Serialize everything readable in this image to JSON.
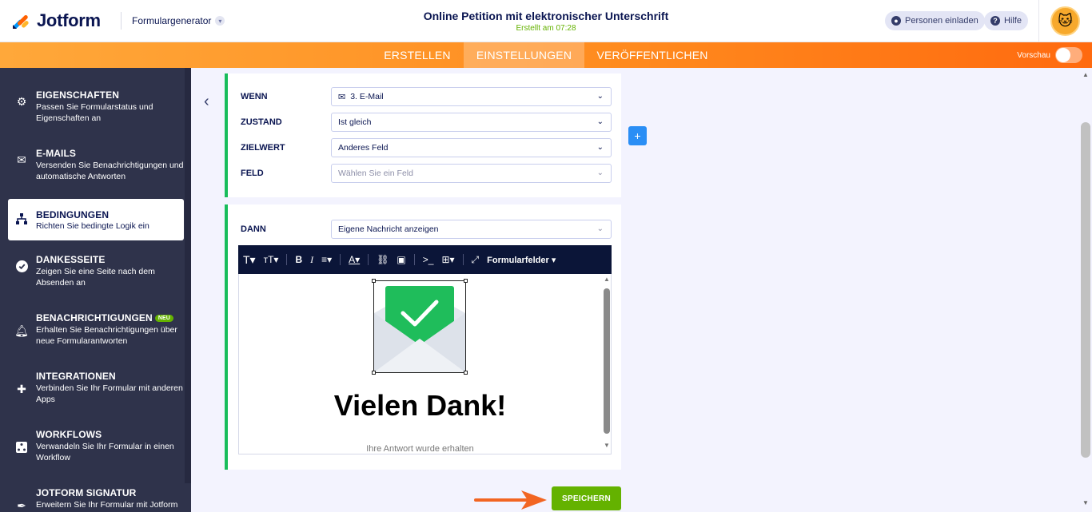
{
  "header": {
    "logo_text": "Jotform",
    "form_builder_label": "Formulargenerator",
    "form_title": "Online Petition mit elektronischer Unterschrift",
    "form_subtitle": "Erstellt am 07:28",
    "invite_label": "Personen einladen",
    "help_label": "Hilfe"
  },
  "nav": {
    "tabs": [
      "ERSTELLEN",
      "EINSTELLUNGEN",
      "VERÖFFENTLICHEN"
    ],
    "active_tab": "EINSTELLUNGEN",
    "preview_label": "Vorschau"
  },
  "sidebar": {
    "items": [
      {
        "title": "EIGENSCHAFTEN",
        "desc": "Passen Sie Formularstatus und Eigenschaften an",
        "icon": "gear-icon"
      },
      {
        "title": "E-MAILS",
        "desc": "Versenden Sie Benachrichtigungen und automatische Antworten",
        "icon": "envelope-icon"
      },
      {
        "title": "BEDINGUNGEN",
        "desc": "Richten Sie bedingte Logik ein",
        "icon": "sitemap-icon",
        "active": true
      },
      {
        "title": "DANKESSEITE",
        "desc": "Zeigen Sie eine Seite nach dem Absenden an",
        "icon": "check-circle-icon"
      },
      {
        "title": "BENACHRICHTIGUNGEN",
        "badge": "NEU",
        "desc": "Erhalten Sie Benachrichtigungen über neue Formularantworten",
        "icon": "bell-icon"
      },
      {
        "title": "INTEGRATIONEN",
        "desc": "Verbinden Sie Ihr Formular mit anderen Apps",
        "icon": "puzzle-icon"
      },
      {
        "title": "WORKFLOWS",
        "desc": "Verwandeln Sie Ihr Formular in einen Workflow",
        "icon": "workflow-icon"
      },
      {
        "title": "JOTFORM SIGNATUR",
        "desc": "Erweitern Sie Ihr Formular mit Jotform",
        "icon": "pen-icon"
      }
    ]
  },
  "condition": {
    "if_label": "WENN",
    "if_value": "3. E-Mail",
    "state_label": "ZUSTAND",
    "state_value": "Ist gleich",
    "target_label": "ZIELWERT",
    "target_value": "Anderes Feld",
    "field_label": "FELD",
    "field_placeholder": "Wählen Sie ein Feld"
  },
  "action": {
    "then_label": "DANN",
    "then_value": "Eigene Nachricht anzeigen",
    "toolbar_fields_label": "Formularfelder",
    "editor_heading": "Vielen Dank!",
    "editor_subtext": "Ihre Antwort wurde erhalten"
  },
  "buttons": {
    "save_label": "SPEICHERN"
  },
  "colors": {
    "accent_orange": "#ff8c1f",
    "condition_green": "#18bd5b",
    "save_green": "#64b200",
    "sidebar_bg": "#2f334b",
    "toolbar_bg": "#0b1538",
    "add_blue": "#2a8ef5"
  }
}
